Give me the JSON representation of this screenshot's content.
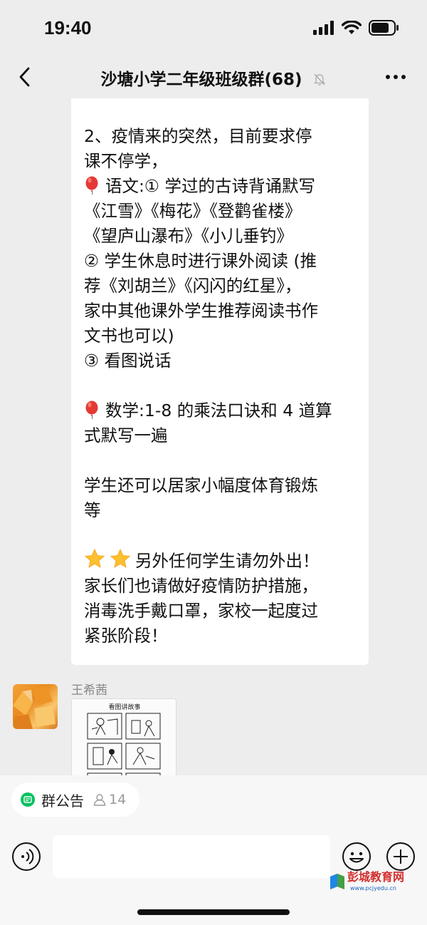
{
  "status_bar": {
    "time": "19:40"
  },
  "nav": {
    "title": "沙塘小学二年级班级群(68)"
  },
  "message": {
    "lines_1": "2、疫情来的突然，目前要求停\n课不停学，",
    "yuwen": "语文:① 学过的古诗背诵默写\n《江雪》《梅花》《登鹳雀楼》\n《望庐山瀑布》《小儿垂钓》\n② 学生休息时进行课外阅读 (推\n荐《刘胡兰》《闪闪的红星》，\n家中其他课外学生推荐阅读书作\n文书也可以)\n③ 看图说话",
    "shuxue": "数学:1-8 的乘法口诀和 4 道算\n式默写一遍",
    "exercise": "学生还可以居家小幅度体育锻炼\n等",
    "notice": "另外任何学生请勿外出！\n家长们也请做好疫情防护措施，\n消毒洗手戴口罩，家校一起度过\n紧张阶段！"
  },
  "next_message": {
    "sender": "王希茜",
    "image_title": "看图讲故事"
  },
  "bottom": {
    "notice_label": "群公告",
    "member_count": "14",
    "input_placeholder": ""
  },
  "watermark": {
    "site": "彭城教育网",
    "url": "www.pcjyedu.cn"
  },
  "colors": {
    "background": "#ededed",
    "bubble": "#ffffff",
    "accent_green": "#07c160"
  }
}
